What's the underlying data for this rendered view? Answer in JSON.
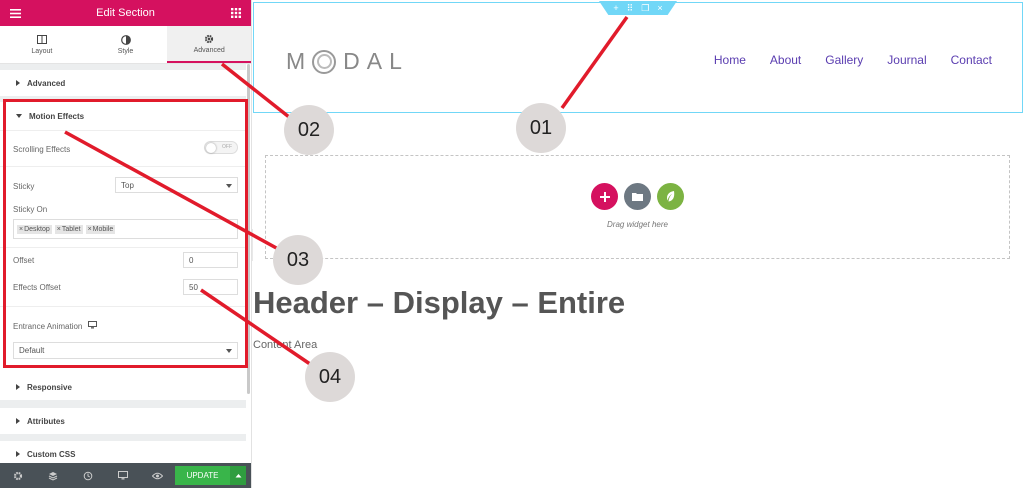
{
  "panel": {
    "title": "Edit Section",
    "tabs": [
      {
        "label": "Layout",
        "icon": "layout-icon"
      },
      {
        "label": "Style",
        "icon": "style-icon"
      },
      {
        "label": "Advanced",
        "icon": "gear-icon"
      }
    ],
    "sections": {
      "advanced": "Advanced",
      "motion_effects": "Motion Effects",
      "responsive": "Responsive",
      "attributes": "Attributes",
      "custom_css": "Custom CSS"
    },
    "motion": {
      "scrolling_effects_label": "Scrolling Effects",
      "scrolling_toggle_text": "OFF",
      "sticky_label": "Sticky",
      "sticky_value": "Top",
      "sticky_on_label": "Sticky On",
      "sticky_on_chips": [
        "Desktop",
        "Tablet",
        "Mobile"
      ],
      "offset_label": "Offset",
      "offset_value": "0",
      "effects_offset_label": "Effects Offset",
      "effects_offset_value": "50",
      "entrance_animation_label": "Entrance Animation",
      "entrance_animation_value": "Default"
    },
    "footer": {
      "update_label": "UPDATE"
    }
  },
  "preview": {
    "logo_text": "DAL",
    "logo_prefix": "M",
    "nav": [
      "Home",
      "About",
      "Gallery",
      "Journal",
      "Contact"
    ],
    "drop_zone_label": "Drag widget here",
    "heading": "Header – Display – Entire",
    "content": "Content Area"
  },
  "annotations": [
    "01",
    "02",
    "03",
    "04"
  ],
  "colors": {
    "brand": "#d5115f",
    "section_outline": "#71d7f7",
    "nav_link": "#5a3db0",
    "annotation_red": "#e11b2b",
    "update_green": "#39b54a"
  }
}
